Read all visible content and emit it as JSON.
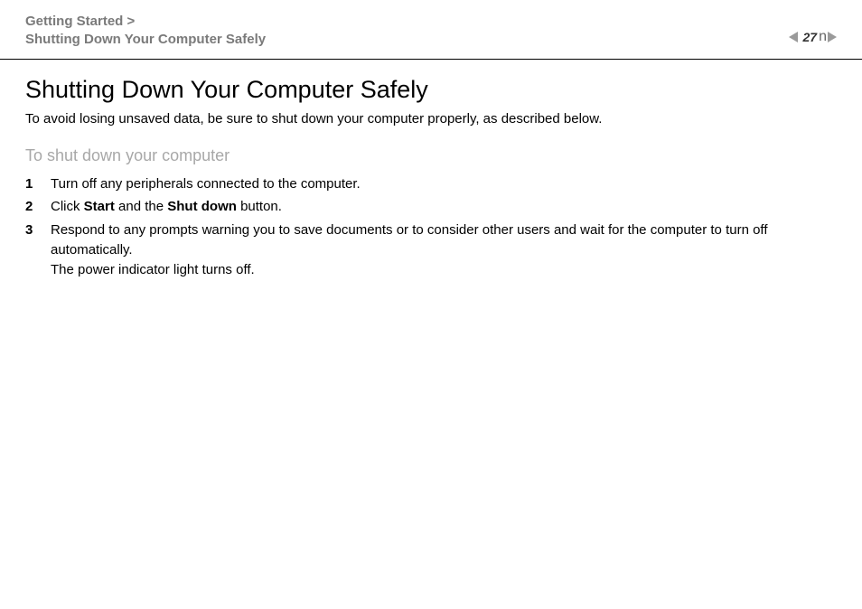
{
  "breadcrumb": {
    "section": "Getting Started >",
    "page": "Shutting Down Your Computer Safely"
  },
  "pager": {
    "page": "27"
  },
  "title": "Shutting Down Your Computer Safely",
  "intro": "To avoid losing unsaved data, be sure to shut down your computer properly, as described below.",
  "subheading": "To shut down your computer",
  "steps": [
    {
      "n": "1",
      "text_plain": "Turn off any peripherals connected to the computer."
    },
    {
      "n": "2",
      "pre": "Click ",
      "b1": "Start",
      "mid": " and the ",
      "b2": "Shut down",
      "post": " button."
    },
    {
      "n": "3",
      "line1": "Respond to any prompts warning you to save documents or to consider other users and wait for the computer to turn off automatically.",
      "line2": "The power indicator light turns off."
    }
  ]
}
